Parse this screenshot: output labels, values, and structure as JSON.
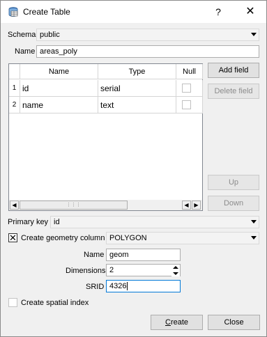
{
  "window": {
    "title": "Create Table",
    "help_glyph": "?",
    "close_glyph": "✕",
    "icon": "database-table-icon"
  },
  "schema": {
    "label": "Schema",
    "value": "public"
  },
  "name": {
    "label": "Name",
    "value": "areas_poly"
  },
  "fields_table": {
    "headers": [
      "Name",
      "Type",
      "Null"
    ],
    "rows": [
      {
        "num": "1",
        "name": "id",
        "type": "serial",
        "null": false
      },
      {
        "num": "2",
        "name": "name",
        "type": "text",
        "null": false
      }
    ]
  },
  "buttons": {
    "add_field": "Add field",
    "delete_field": "Delete field",
    "up": "Up",
    "down": "Down",
    "create_prefix": "C",
    "create_rest": "reate",
    "close": "Close"
  },
  "primary_key": {
    "label": "Primary key",
    "value": "id"
  },
  "geometry": {
    "checkbox_label": "Create geometry column",
    "checked": true,
    "type_value": "POLYGON",
    "name_label": "Name",
    "name_value": "geom",
    "dimensions_label": "Dimensions",
    "dimensions_value": "2",
    "srid_label": "SRID",
    "srid_value": "4326"
  },
  "spatial_index": {
    "label": "Create spatial index",
    "checked": false
  }
}
